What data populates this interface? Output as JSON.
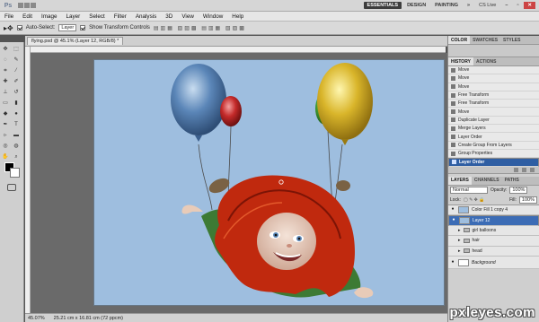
{
  "app": {
    "logo": "Ps"
  },
  "workspaces": {
    "essentials": "ESSENTIALS",
    "design": "DESIGN",
    "painting": "PAINTING",
    "more": "»",
    "cslive": "CS Live"
  },
  "menus": [
    "File",
    "Edit",
    "Image",
    "Layer",
    "Select",
    "Filter",
    "Analysis",
    "3D",
    "View",
    "Window",
    "Help"
  ],
  "options": {
    "auto_select_label": "Auto-Select:",
    "auto_select_value": "Layer",
    "transform_label": "Show Transform Controls"
  },
  "document": {
    "tab_title": "flying.psd @ 45.1% (Layer 12, RGB/8) *"
  },
  "status": {
    "zoom": "45.07%",
    "doc_size": "25.21 cm x 16.81 cm (72 ppcm)"
  },
  "panels": {
    "color_tabs": [
      "COLOR",
      "SWATCHES",
      "STYLES"
    ],
    "history_tabs": [
      "HISTORY",
      "ACTIONS"
    ],
    "history_items": [
      "Move",
      "Move",
      "Move",
      "Free Transform",
      "Free Transform",
      "Move",
      "Duplicate Layer",
      "Merge Layers",
      "Layer Order",
      "Create Group From Layers",
      "Group Properties",
      "Layer Order"
    ],
    "layers_tabs": [
      "LAYERS",
      "CHANNELS",
      "PATHS"
    ],
    "blend_mode": "Normal",
    "opacity_label": "Opacity:",
    "opacity_value": "100%",
    "lock_label": "Lock:",
    "fill_label": "Fill:",
    "fill_value": "100%",
    "layers": [
      "Color Fill 1 copy 4",
      "Layer 12",
      "girl balloons",
      "hair",
      "head",
      "Background"
    ]
  },
  "watermark": "pxleyes.com",
  "colors": {
    "canvas_bg": "#9ebedf",
    "selection": "#2f5ea3",
    "hair": "#c0290e",
    "shirt": "#3d7a34"
  }
}
